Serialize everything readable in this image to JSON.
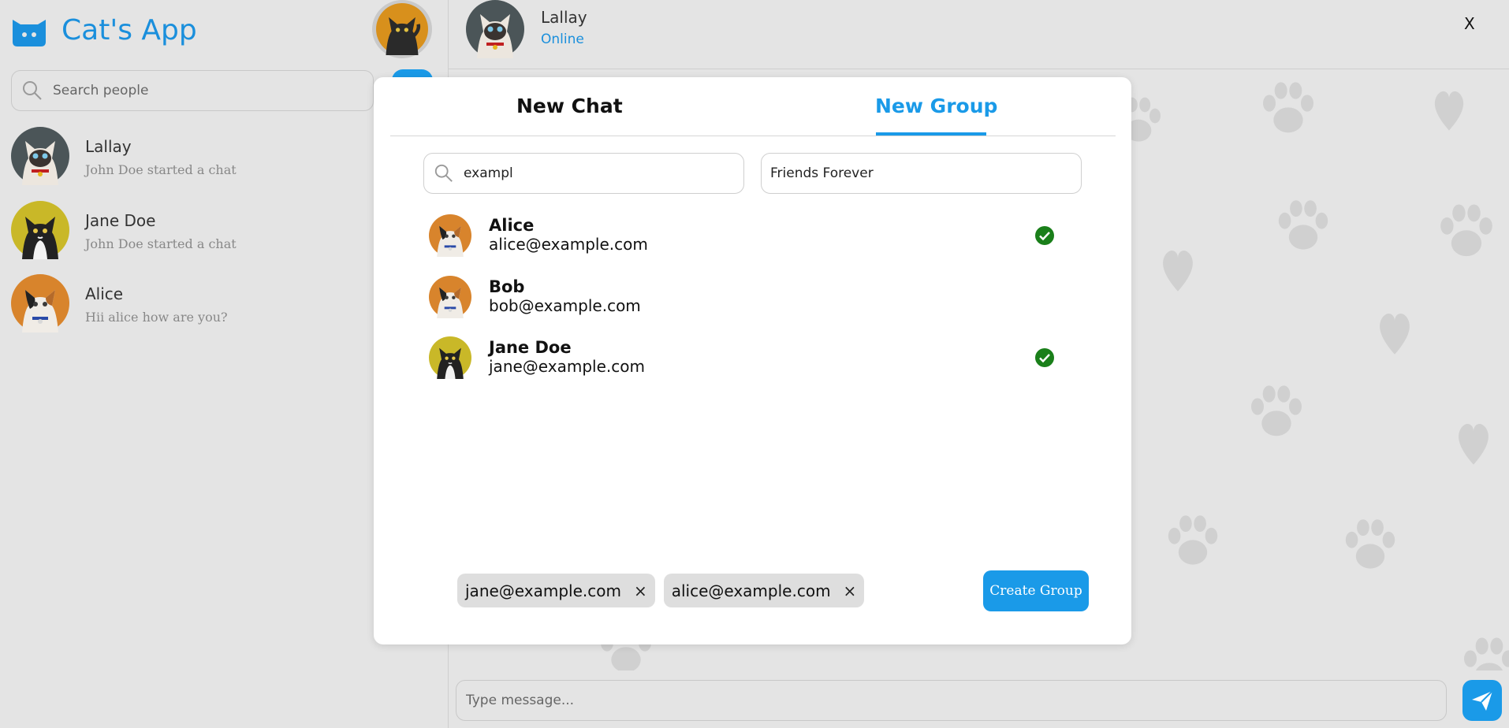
{
  "app": {
    "name": "Cat's App",
    "accent": "#1a9ae8"
  },
  "sidebar": {
    "search_placeholder": "Search people",
    "contacts": [
      {
        "name": "Lallay",
        "last_message": "John Doe started a chat",
        "avatar": "siamese-cat-avatar"
      },
      {
        "name": "Jane Doe",
        "last_message": "John Doe started a chat",
        "avatar": "tuxedo-cat-avatar"
      },
      {
        "name": "Alice",
        "last_message": "Hii alice how are you?",
        "avatar": "calico-cat-avatar"
      }
    ]
  },
  "chat": {
    "contact_name": "Lallay",
    "status": "Online",
    "close_label": "X",
    "message_placeholder": "Type message..."
  },
  "modal": {
    "tabs": [
      {
        "label": "New Chat",
        "active": false
      },
      {
        "label": "New Group",
        "active": true
      }
    ],
    "search_value": "exampl",
    "group_name_value": "Friends Forever",
    "users": [
      {
        "name": "Alice",
        "email": "alice@example.com",
        "selected": true
      },
      {
        "name": "Bob",
        "email": "bob@example.com",
        "selected": false
      },
      {
        "name": "Jane Doe",
        "email": "jane@example.com",
        "selected": true
      }
    ],
    "selected_chips": [
      "jane@example.com",
      "alice@example.com"
    ],
    "chip_remove_label": "×",
    "create_button_label": "Create Group"
  },
  "colors": {
    "selected_check": "#1a7f1a",
    "brand_text": "#1a8fdc"
  }
}
